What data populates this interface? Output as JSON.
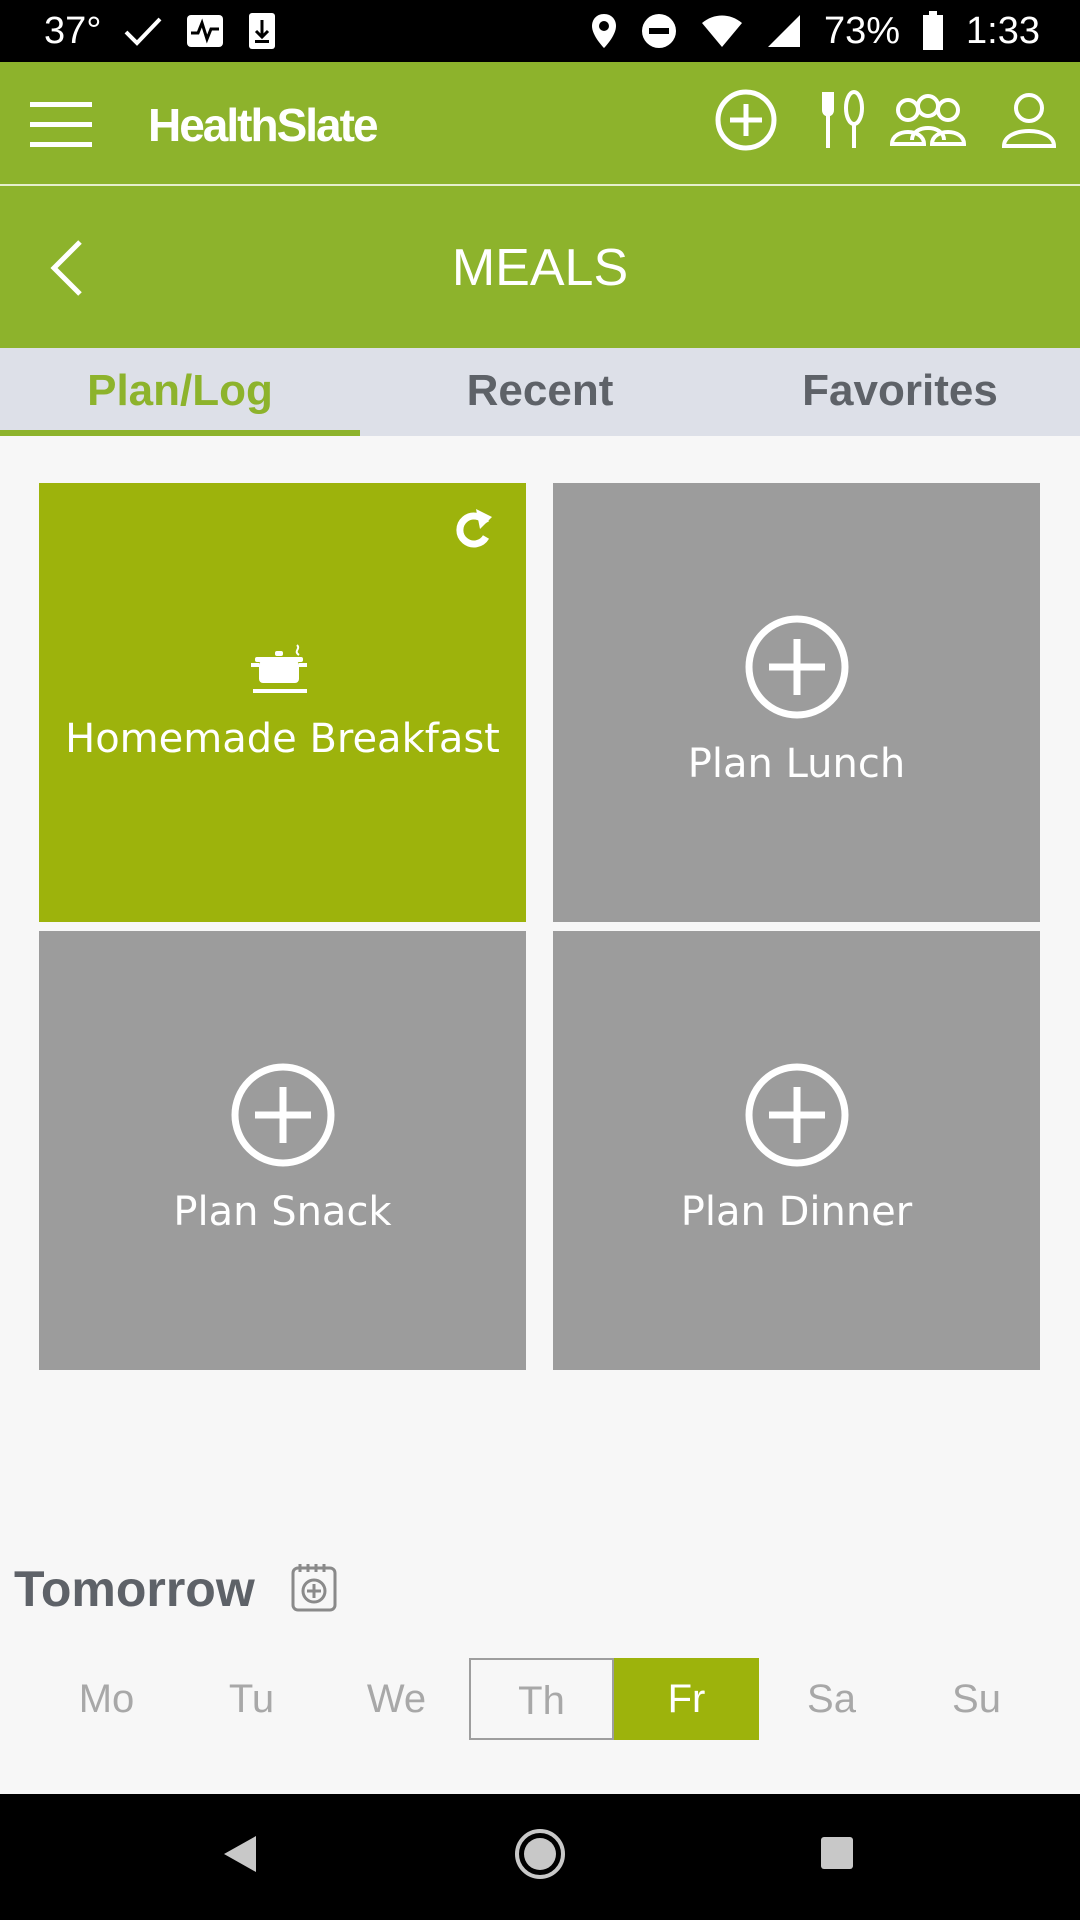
{
  "status": {
    "temperature": "37°",
    "battery": "73%",
    "time": "1:33"
  },
  "app": {
    "brand": "HealthSlate"
  },
  "page": {
    "title": "MEALS"
  },
  "tabs": [
    {
      "label": "Plan/Log"
    },
    {
      "label": "Recent"
    },
    {
      "label": "Favorites"
    }
  ],
  "meals": [
    {
      "label": "Homemade Breakfast",
      "state": "logged"
    },
    {
      "label": "Plan Lunch",
      "state": "empty"
    },
    {
      "label": "Plan Snack",
      "state": "empty"
    },
    {
      "label": "Plan Dinner",
      "state": "empty"
    }
  ],
  "tomorrow": {
    "label": "Tomorrow"
  },
  "days": [
    {
      "label": "Mo"
    },
    {
      "label": "Tu"
    },
    {
      "label": "We"
    },
    {
      "label": "Th"
    },
    {
      "label": "Fr"
    },
    {
      "label": "Sa"
    },
    {
      "label": "Su"
    }
  ],
  "colors": {
    "brand_green": "#8db32c",
    "tile_green": "#9db30c",
    "tile_gray": "#9c9c9c"
  }
}
